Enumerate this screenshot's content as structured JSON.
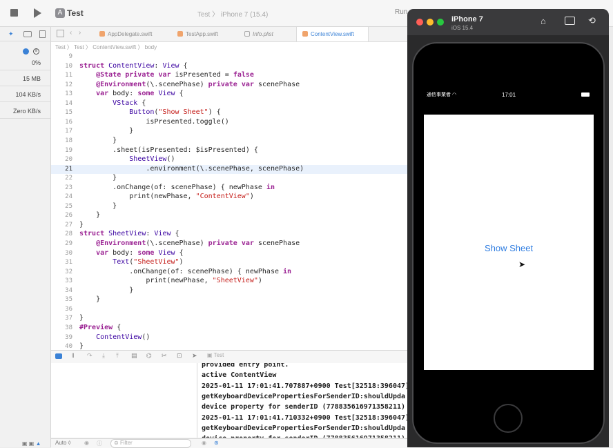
{
  "toolbar": {
    "app_title": "Test",
    "scheme": "Test 〉 iPhone 7 (15.4)",
    "run_status": "Run"
  },
  "tabs": [
    "AppDelegate.swift",
    "TestApp.swift",
    "Info.plist",
    "ContentView.swift"
  ],
  "jumpbar": {
    "parts": [
      "Test",
      "Test",
      "ContentView.swift",
      "body"
    ]
  },
  "metrics": {
    "cpu": "0%",
    "memory": "15 MB",
    "network": "104 KB/s",
    "disk": "Zero KB/s"
  },
  "editor": {
    "current_line": 21,
    "lines": [
      {
        "n": "9",
        "t": ""
      },
      {
        "n": "10",
        "t": "struct ContentView: View {"
      },
      {
        "n": "11",
        "t": "    @State private var isPresented = false"
      },
      {
        "n": "12",
        "t": "    @Environment(\\.scenePhase) private var scenePhase"
      },
      {
        "n": "13",
        "t": "    var body: some View {"
      },
      {
        "n": "14",
        "t": "        VStack {"
      },
      {
        "n": "15",
        "t": "            Button(\"Show Sheet\") {"
      },
      {
        "n": "16",
        "t": "                isPresented.toggle()"
      },
      {
        "n": "17",
        "t": "            }"
      },
      {
        "n": "18",
        "t": "        }"
      },
      {
        "n": "19",
        "t": "        .sheet(isPresented: $isPresented) {"
      },
      {
        "n": "20",
        "t": "            SheetView()"
      },
      {
        "n": "21",
        "t": "                .environment(\\.scenePhase, scenePhase)"
      },
      {
        "n": "22",
        "t": "        }"
      },
      {
        "n": "23",
        "t": "        .onChange(of: scenePhase) { newPhase in"
      },
      {
        "n": "24",
        "t": "            print(newPhase, \"ContentView\")"
      },
      {
        "n": "25",
        "t": "        }"
      },
      {
        "n": "26",
        "t": "    }"
      },
      {
        "n": "27",
        "t": "}"
      },
      {
        "n": "28",
        "t": "struct SheetView: View {"
      },
      {
        "n": "29",
        "t": "    @Environment(\\.scenePhase) private var scenePhase"
      },
      {
        "n": "30",
        "t": "    var body: some View {"
      },
      {
        "n": "31",
        "t": "        Text(\"SheetView\")"
      },
      {
        "n": "32",
        "t": "            .onChange(of: scenePhase) { newPhase in"
      },
      {
        "n": "33",
        "t": "                print(newPhase, \"SheetView\")"
      },
      {
        "n": "34",
        "t": "            }"
      },
      {
        "n": "35",
        "t": "    }"
      },
      {
        "n": "36",
        "t": ""
      },
      {
        "n": "37",
        "t": "}"
      },
      {
        "n": "38",
        "t": "#Preview {"
      },
      {
        "n": "39",
        "t": "    ContentView()"
      },
      {
        "n": "40",
        "t": "}"
      }
    ]
  },
  "debug": {
    "target_label": "Test",
    "filter_placeholder": "Filter",
    "auto_label": "Auto ◊"
  },
  "console": [
    "provided entry point.",
    "active ContentView",
    "2025-01-11 17:01:41.707887+0900 Test[32518:396047]",
    "getKeyboardDevicePropertiesForSenderID:shouldUpda",
    "device property for senderID (778835616971358211)",
    "2025-01-11 17:01:41.710332+0900 Test[32518:396047]",
    "getKeyboardDevicePropertiesForSenderID:shouldUpda",
    "device property for senderID (778835616971358211)"
  ],
  "simulator": {
    "device_name": "iPhone 7",
    "os_version": "iOS 15.4",
    "carrier": "通信事業者",
    "time": "17:01",
    "button_label": "Show Sheet"
  },
  "colors": {
    "accent": "#3b82d6",
    "keyword": "#9b2393",
    "string": "#c41a16",
    "current_line": "#e9f1fc"
  }
}
